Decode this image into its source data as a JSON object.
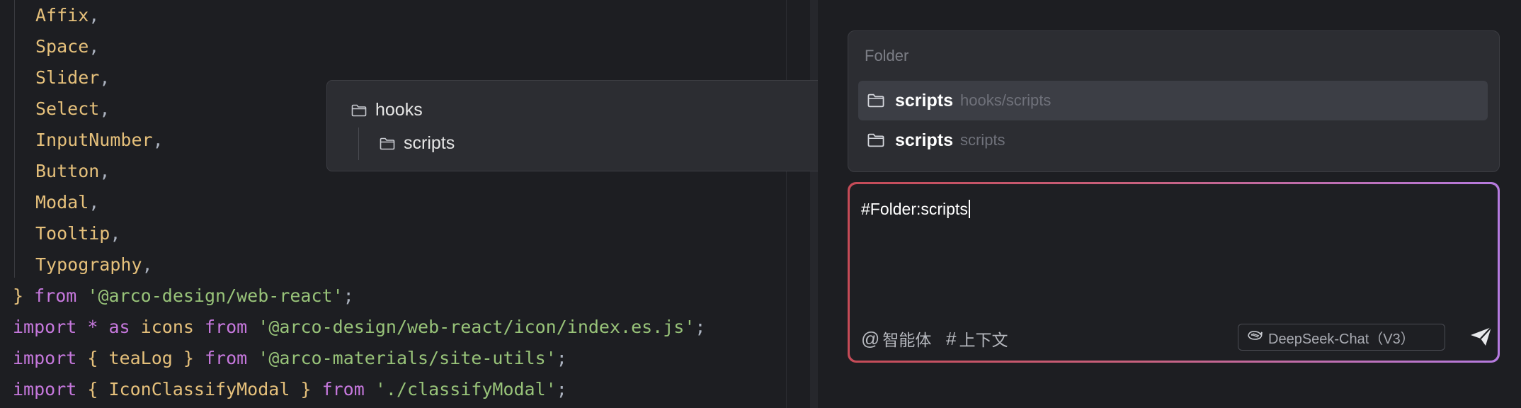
{
  "editor": {
    "lines": [
      {
        "name": "Affix"
      },
      {
        "name": "Space"
      },
      {
        "name": "Slider"
      },
      {
        "name": "Select"
      },
      {
        "name": "InputNumber"
      },
      {
        "name": "Button"
      },
      {
        "name": "Modal"
      },
      {
        "name": "Tooltip"
      },
      {
        "name": "Typography"
      }
    ],
    "comma": ",",
    "close_brace": "}",
    "kw_from": "from",
    "kw_import": "import",
    "kw_as": "as",
    "star": "*",
    "semi": ";",
    "lbrace": "{",
    "rbrace": "}",
    "src_web_react": "'@arco-design/web-react'",
    "ident_icons": "icons",
    "src_icon": "'@arco-design/web-react/icon/index.es.js'",
    "ident_tealog": "teaLog",
    "src_site_utils": "'@arco-materials/site-utils'",
    "ident_classify": "IconClassifyModal",
    "src_classify": "'./classifyModal'"
  },
  "tree_popup": {
    "parent": "hooks",
    "child": "scripts"
  },
  "suggest": {
    "header": "Folder",
    "items": [
      {
        "name": "scripts",
        "path": "hooks/scripts",
        "active": true
      },
      {
        "name": "scripts",
        "path": "scripts",
        "active": false
      }
    ]
  },
  "input": {
    "value": "#Folder:scripts",
    "agent_symbol": "@",
    "agent_label": "智能体",
    "context_symbol": "#",
    "context_label": "上下文",
    "model_label": "DeepSeek-Chat（V3）"
  },
  "colors": {
    "editor_bg": "#1d1e22",
    "identifier": "#e5c07b",
    "keyword": "#c678dd",
    "string": "#98c379",
    "popup_bg": "#2c2d32",
    "gradient_start": "#c54b57",
    "gradient_end": "#b67be0"
  }
}
